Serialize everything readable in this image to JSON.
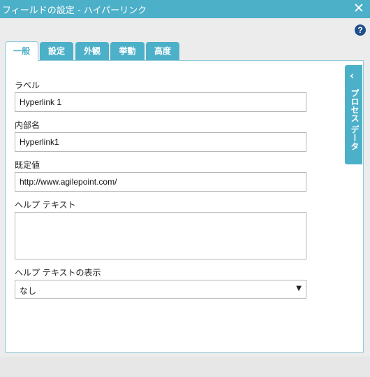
{
  "window": {
    "title": "フィールドの設定 - ハイパーリンク",
    "close_glyph": "✕",
    "help_glyph": "?"
  },
  "tabs": [
    {
      "label": "一般",
      "active": true
    },
    {
      "label": "設定"
    },
    {
      "label": "外観"
    },
    {
      "label": "挙動"
    },
    {
      "label": "高度"
    }
  ],
  "form": {
    "label_field": {
      "label": "ラベル",
      "value": "Hyperlink 1"
    },
    "internal_name": {
      "label": "内部名",
      "value": "Hyperlink1"
    },
    "default_value": {
      "label": "既定値",
      "value": "http://www.agilepoint.com/"
    },
    "help_text": {
      "label": "ヘルプ テキスト",
      "value": ""
    },
    "help_display": {
      "label": "ヘルプ テキストの表示",
      "selected": "なし",
      "arrow": "▼"
    }
  },
  "side_panel": {
    "label": "プロセス データ",
    "chevron": "‹"
  },
  "colors": {
    "accent": "#4db0c9",
    "border": "#8fcadb",
    "help": "#1f4e8c"
  }
}
